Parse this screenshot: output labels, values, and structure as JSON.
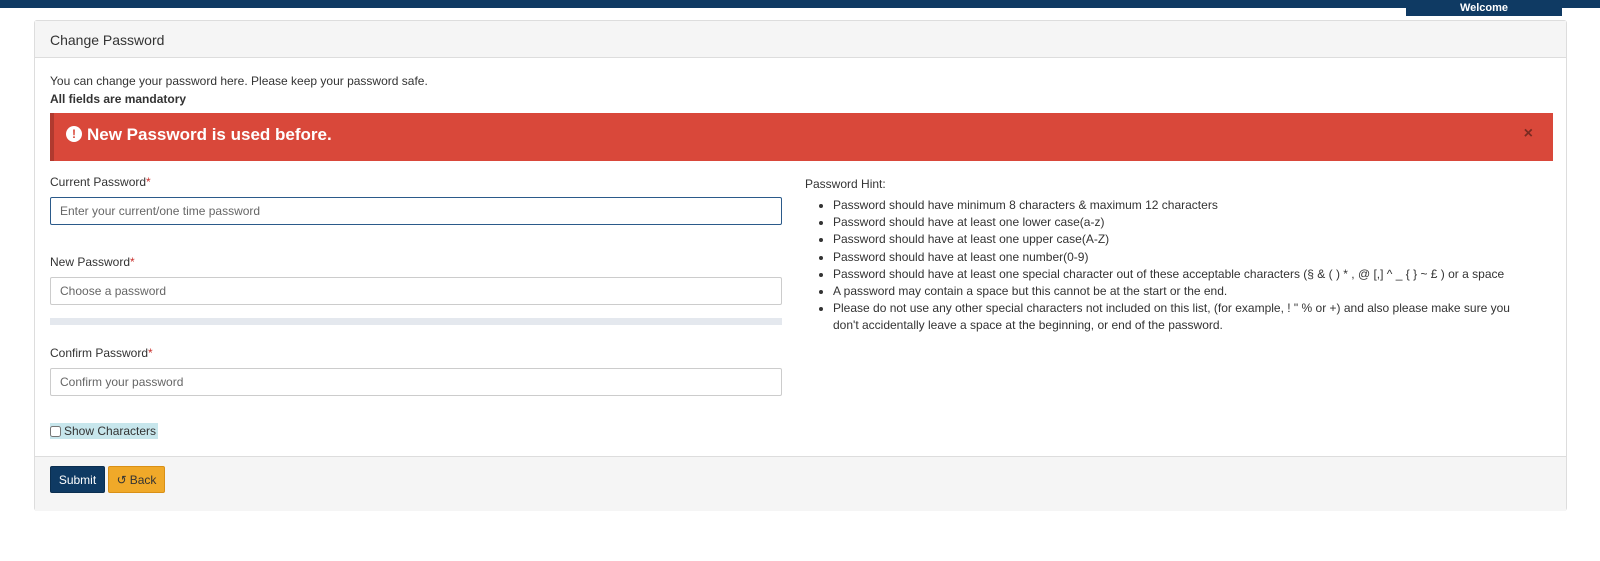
{
  "header": {
    "welcome": "Welcome"
  },
  "panel": {
    "title": "Change Password",
    "intro": "You can change your password here. Please keep your password safe.",
    "mandatory": "All fields are mandatory"
  },
  "alert": {
    "message": "New Password is used before.",
    "icon": "exclamation-circle-icon",
    "close_icon": "×",
    "color": "#d9483a"
  },
  "form": {
    "current_password": {
      "label": "Current Password",
      "required_mark": "*",
      "placeholder": "Enter your current/one time password",
      "value": ""
    },
    "new_password": {
      "label": "New Password",
      "required_mark": "*",
      "placeholder": "Choose a password",
      "value": "",
      "strength": 0
    },
    "confirm_password": {
      "label": "Confirm Password",
      "required_mark": "*",
      "placeholder": "Confirm your password",
      "value": ""
    },
    "show_characters": {
      "label": "Show Characters",
      "checked": false
    }
  },
  "hints": {
    "title": "Password Hint:",
    "items": [
      "Password should have minimum 8 characters & maximum 12 characters",
      "Password should have at least one lower case(a-z)",
      "Password should have at least one upper case(A-Z)",
      "Password should have at least one number(0-9)",
      "Password should have at least one special character out of these acceptable characters (§ & ( ) * , @ [,] ^ _ { } ~ £ ) or a space",
      "A password may contain a space but this cannot be at the start or the end.",
      "Please do not use any other special characters not included on this list, (for example, ! \" % or +) and also please make sure you don't accidentally leave a space at the beginning, or end of the password."
    ]
  },
  "footer": {
    "submit_label": "Submit",
    "back_label": "Back",
    "back_icon": "undo-icon"
  },
  "colors": {
    "brand": "#0f3a63",
    "alert": "#d9483a",
    "back_button": "#f0a929"
  }
}
